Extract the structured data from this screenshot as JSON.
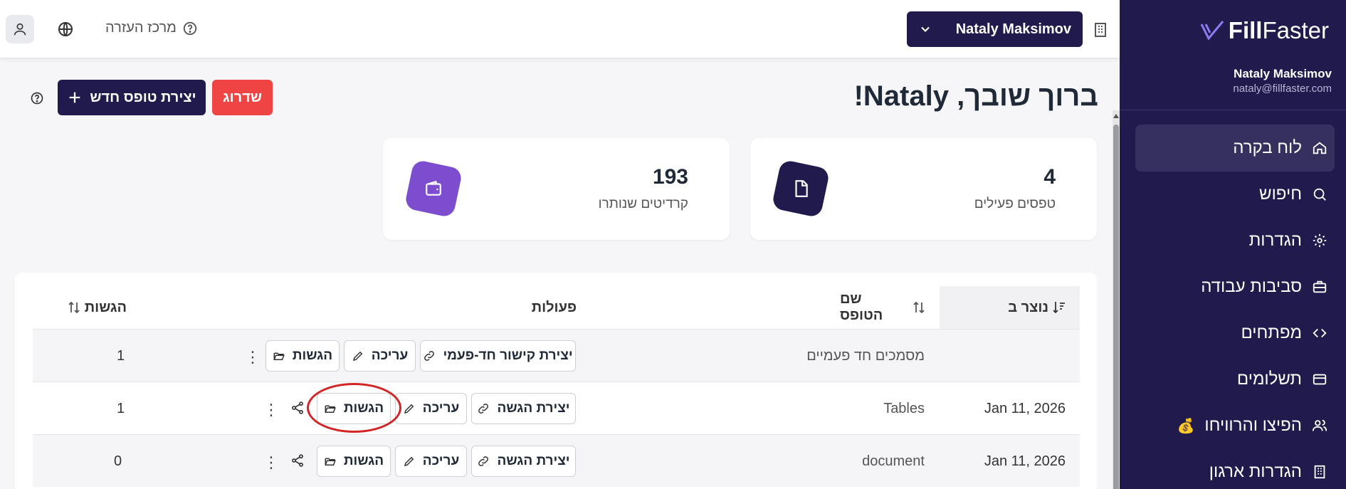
{
  "topbar": {
    "help_center": "מרכז העזרה",
    "user_dropdown": "Nataly Maksimov"
  },
  "sidebar": {
    "logo_bold": "Fill",
    "logo_light": "Faster",
    "user_name": "Nataly Maksimov",
    "user_email": "nataly@fillfaster.com",
    "items": [
      {
        "label": "לוח בקרה",
        "icon": "home-icon"
      },
      {
        "label": "חיפוש",
        "icon": "search-icon"
      },
      {
        "label": "הגדרות",
        "icon": "gear-icon"
      },
      {
        "label": "סביבות עבודה",
        "icon": "briefcase-icon"
      },
      {
        "label": "מפתחים",
        "icon": "code-icon"
      },
      {
        "label": "תשלומים",
        "icon": "credit-card-icon"
      },
      {
        "label": "הפיצו והרוויחו",
        "icon": "users-icon",
        "emoji": "💰"
      },
      {
        "label": "הגדרות ארגון",
        "icon": "building-icon"
      }
    ]
  },
  "header": {
    "welcome": "ברוך שובך, Nataly!",
    "new_form_button": "יצירת טופס חדש",
    "upgrade_button": "שדרוג"
  },
  "stats": {
    "active_forms_value": "4",
    "active_forms_label": "טפסים פעילים",
    "credits_value": "193",
    "credits_label": "קרדיטים שנותרו"
  },
  "table": {
    "headers": {
      "created": "נוצר ב",
      "form_name": "שם הטופס",
      "actions": "פעולות",
      "submissions": "הגשות"
    },
    "rows": [
      {
        "created": "",
        "name": "מסמכים חד פעמיים",
        "primary_action": "יצירת קישור חד-פעמי",
        "edit": "עריכה",
        "submissions_btn": "הגשות",
        "submissions": "1"
      },
      {
        "created": "Jan 11, 2026",
        "name": "Tables",
        "primary_action": "יצירת הגשה",
        "edit": "עריכה",
        "submissions_btn": "הגשות",
        "submissions": "1"
      },
      {
        "created": "Jan 11, 2026",
        "name": "document",
        "primary_action": "יצירת הגשה",
        "edit": "עריכה",
        "submissions_btn": "הגשות",
        "submissions": "0"
      }
    ]
  },
  "colors": {
    "brand_navy": "#201a4d",
    "upgrade_red": "#ef4444",
    "credits_purple": "#7c4dce",
    "annotation_red": "#d22525"
  }
}
